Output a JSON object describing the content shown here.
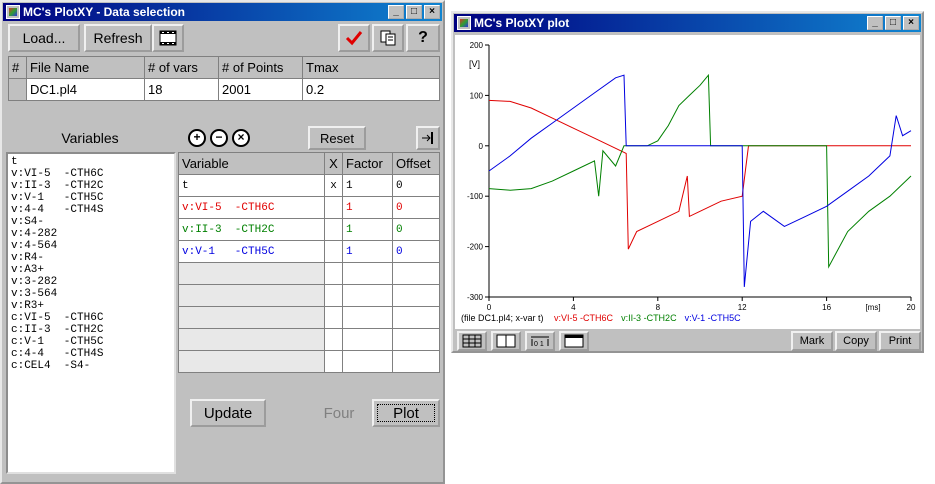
{
  "left_window": {
    "title": "MC's PlotXY - Data selection",
    "load_label": "Load...",
    "refresh_label": "Refresh",
    "file_table": {
      "headers": [
        "#",
        "File Name",
        "# of vars",
        "# of Points",
        "Tmax"
      ],
      "row": {
        "num": "",
        "file": "DC1.pl4",
        "vars": "18",
        "points": "2001",
        "tmax": "0.2"
      }
    },
    "variables_label": "Variables",
    "reset_label": "Reset",
    "variables": [
      "t",
      "v:VI-5  -CTH6C",
      "v:II-3  -CTH2C",
      "v:V-1   -CTH5C",
      "v:4-4   -CTH4S",
      "v:S4-",
      "v:4-282",
      "v:4-564",
      "v:R4-",
      "v:A3+",
      "v:3-282",
      "v:3-564",
      "v:R3+",
      "c:VI-5  -CTH6C",
      "c:II-3  -CTH2C",
      "c:V-1   -CTH5C",
      "c:4-4   -CTH4S",
      "c:CEL4  -S4-"
    ],
    "sel_table": {
      "headers": [
        "Variable",
        "X",
        "Factor",
        "Offset"
      ],
      "rows": [
        {
          "variable": "t",
          "x": "x",
          "factor": "1",
          "offset": "0",
          "color": "#000000"
        },
        {
          "variable": "v:VI-5  -CTH6C",
          "x": "",
          "factor": "1",
          "offset": "0",
          "color": "#e00000"
        },
        {
          "variable": "v:II-3  -CTH2C",
          "x": "",
          "factor": "1",
          "offset": "0",
          "color": "#008000"
        },
        {
          "variable": "v:V-1   -CTH5C",
          "x": "",
          "factor": "1",
          "offset": "0",
          "color": "#0000e0"
        }
      ],
      "empty_rows": 5
    },
    "update_label": "Update",
    "four_label": "Four",
    "plot_label": "Plot"
  },
  "right_window": {
    "title": "MC's PlotXY plot",
    "unit_label": "[V]",
    "xunit_label": "[ms]",
    "legend_prefix": "(file DC1.pl4; x-var t)",
    "mark_label": "Mark",
    "copy_label": "Copy",
    "print_label": "Print"
  },
  "chart_data": {
    "type": "line",
    "xlabel": "[ms]",
    "ylabel": "[V]",
    "xlim": [
      0,
      20
    ],
    "ylim": [
      -300,
      200
    ],
    "xticks": [
      "0",
      "4",
      "8",
      "12",
      "16",
      "20"
    ],
    "yticks": [
      "200",
      "100",
      "0",
      "-100",
      "-200",
      "-300"
    ],
    "series": [
      {
        "name": "v:VI-5 -CTH6C",
        "color": "#e00000",
        "x": [
          0,
          1,
          2,
          3,
          4,
          5,
          6,
          6.5,
          6.6,
          7,
          8,
          9,
          9.4,
          9.5,
          10,
          11,
          12,
          12.3,
          12.5,
          13,
          14,
          15,
          16,
          16.2,
          17,
          18,
          19,
          20
        ],
        "y": [
          90,
          88,
          75,
          55,
          35,
          15,
          -5,
          -15,
          -205,
          -170,
          -150,
          -130,
          -60,
          -140,
          -130,
          -110,
          -100,
          0,
          0,
          0,
          0,
          0,
          0,
          0,
          0,
          0,
          0,
          0
        ]
      },
      {
        "name": "v:II-3 -CTH2C",
        "color": "#008000",
        "x": [
          0,
          1,
          2,
          3,
          4,
          5,
          5.2,
          5.4,
          6,
          6.4,
          7,
          7.5,
          8,
          8.5,
          9,
          9.5,
          10,
          10.4,
          10.5,
          11,
          12,
          13,
          14,
          15,
          15.5,
          16,
          16.1,
          17,
          18,
          19,
          20
        ],
        "y": [
          -85,
          -88,
          -85,
          -70,
          -50,
          -30,
          -100,
          -10,
          -40,
          0,
          0,
          0,
          10,
          40,
          80,
          100,
          120,
          140,
          0,
          0,
          0,
          0,
          0,
          0,
          0,
          0,
          -240,
          -170,
          -130,
          -100,
          -60
        ]
      },
      {
        "name": "v:V-1 -CTH5C",
        "color": "#0000e0",
        "x": [
          0,
          1,
          2,
          3,
          4,
          5,
          6,
          6.4,
          6.5,
          7,
          8,
          9,
          10,
          11,
          12,
          12.1,
          12.4,
          13,
          14,
          15,
          16,
          17,
          18,
          19,
          19.3,
          19.6,
          20
        ],
        "y": [
          -50,
          -20,
          15,
          45,
          75,
          105,
          135,
          140,
          0,
          0,
          0,
          0,
          0,
          0,
          0,
          -280,
          -150,
          -130,
          -160,
          -140,
          -120,
          -90,
          -60,
          -20,
          60,
          20,
          30
        ]
      }
    ]
  }
}
